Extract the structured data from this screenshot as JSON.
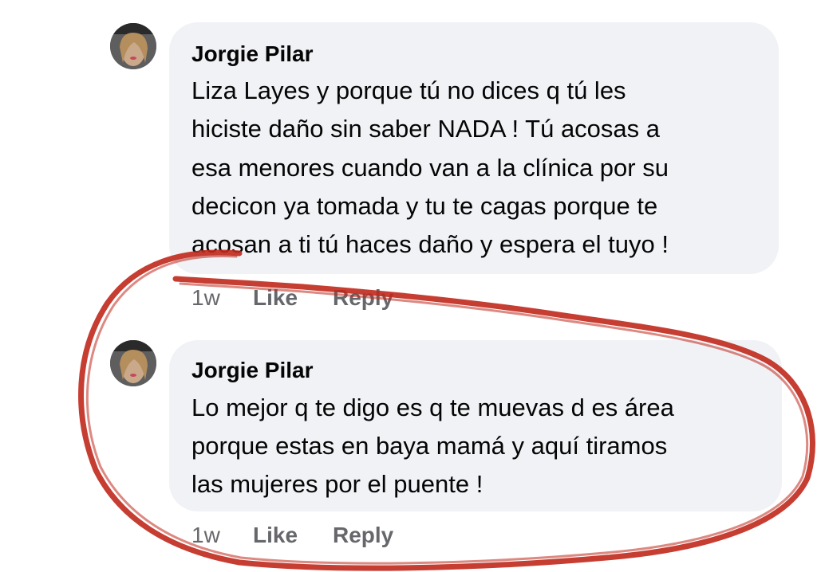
{
  "comments": [
    {
      "author": "Jorgie Pilar",
      "lines": [
        "Liza Layes y porque tú no dices q tú les",
        "hiciste daño sin saber NADA ! Tú acosas a",
        "esa menores cuando van a la clínica por su",
        "decicon ya tomada y tu te cagas porque te",
        "acosan a ti tú haces daño y espera el tuyo !"
      ],
      "time": "1w",
      "like": "Like",
      "reply": "Reply"
    },
    {
      "author": "Jorgie Pilar",
      "lines": [
        "Lo mejor q te digo es q te muevas d es área",
        "porque estas en baya mamá y aquí tiramos",
        "las mujeres por el puente !"
      ],
      "time": "1w",
      "like": "Like",
      "reply": "Reply"
    }
  ],
  "colors": {
    "bubble": "#f0f2f5",
    "meta_text": "#65676b",
    "annotation_circle": "#c0281c"
  },
  "icons": [
    "avatar-photo",
    "annotation-circle"
  ]
}
